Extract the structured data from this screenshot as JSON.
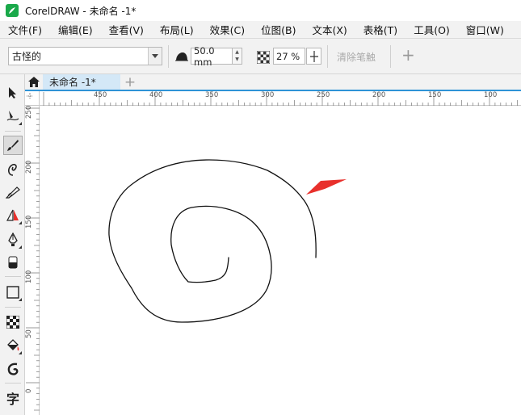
{
  "window": {
    "title": "CorelDRAW - 未命名 -1*"
  },
  "menu": [
    "文件(F)",
    "编辑(E)",
    "查看(V)",
    "布局(L)",
    "效果(C)",
    "位图(B)",
    "文本(X)",
    "表格(T)",
    "工具(O)",
    "窗口(W)"
  ],
  "propbar": {
    "style_preset": "古怪的",
    "stroke_width": "50.0 mm",
    "transparency": "27 %",
    "clear_label": "清除笔触",
    "add_label": "+"
  },
  "tabs": {
    "document": "未命名 -1*",
    "new_tab": "+"
  },
  "ruler_h": [
    "450",
    "400",
    "350",
    "300",
    "250",
    "200",
    "150",
    "100"
  ],
  "ruler_v": [
    "250",
    "200",
    "150",
    "100",
    "50",
    "0"
  ],
  "tools": [
    "pick-tool",
    "shape-tool",
    "artistic-media-tool",
    "freehand-tool",
    "smart-drawing-tool",
    "parallel-dimension-tool",
    "pen-tool",
    "eraser-tool",
    "rectangle-tool",
    "transparency-tool",
    "interactive-fill-tool",
    "contour-tool",
    "text-tool"
  ],
  "text_tool_glyph": "字",
  "colors": {
    "accent": "#2f93d6",
    "arrow": "#e8302c",
    "tab_active": "#d4e8f7",
    "app_green": "#1aa94a"
  }
}
